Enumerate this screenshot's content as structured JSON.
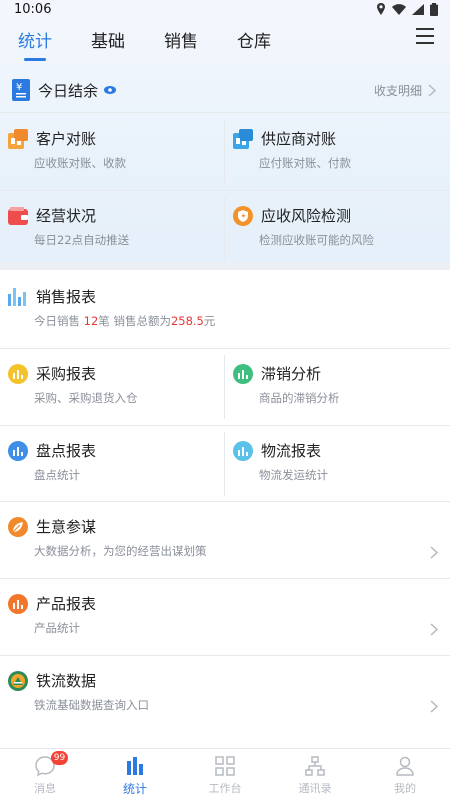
{
  "status": {
    "time": "10:06"
  },
  "tabs": [
    {
      "label": "统计",
      "active": true
    },
    {
      "label": "基础"
    },
    {
      "label": "销售"
    },
    {
      "label": "仓库"
    }
  ],
  "balance": {
    "title": "今日结余",
    "detail_label": "收支明细"
  },
  "cards": {
    "customer": {
      "title": "客户对账",
      "sub": "应收账对账、收款"
    },
    "supplier": {
      "title": "供应商对账",
      "sub": "应付账对账、付款"
    },
    "business": {
      "title": "经营状况",
      "sub": "每日22点自动推送"
    },
    "risk": {
      "title": "应收风险检测",
      "sub": "检测应收账可能的风险"
    },
    "sales": {
      "title": "销售报表",
      "sub_prefix": "今日销售",
      "count": "12",
      "count_unit": "笔  销售总额为",
      "amount": "258.5",
      "amount_unit": "元"
    },
    "purchase": {
      "title": "采购报表",
      "sub": "采购、采购退货入仓"
    },
    "slow": {
      "title": "滞销分析",
      "sub": "商品的滞销分析"
    },
    "inventory": {
      "title": "盘点报表",
      "sub": "盘点统计"
    },
    "logistics": {
      "title": "物流报表",
      "sub": "物流发运统计"
    },
    "advisor": {
      "title": "生意参谋",
      "sub": "大数据分析，为您的经营出谋划策"
    },
    "product": {
      "title": "产品报表",
      "sub": "产品统计"
    },
    "railway": {
      "title": "铁流数据",
      "sub": "铁流基础数据查询入口"
    }
  },
  "bottom_nav": [
    {
      "label": "消息",
      "badge": "99",
      "icon": "message-icon"
    },
    {
      "label": "统计",
      "active": true,
      "icon": "chart-icon"
    },
    {
      "label": "工作台",
      "icon": "grid-icon"
    },
    {
      "label": "通讯录",
      "icon": "org-icon"
    },
    {
      "label": "我的",
      "icon": "user-icon"
    }
  ]
}
